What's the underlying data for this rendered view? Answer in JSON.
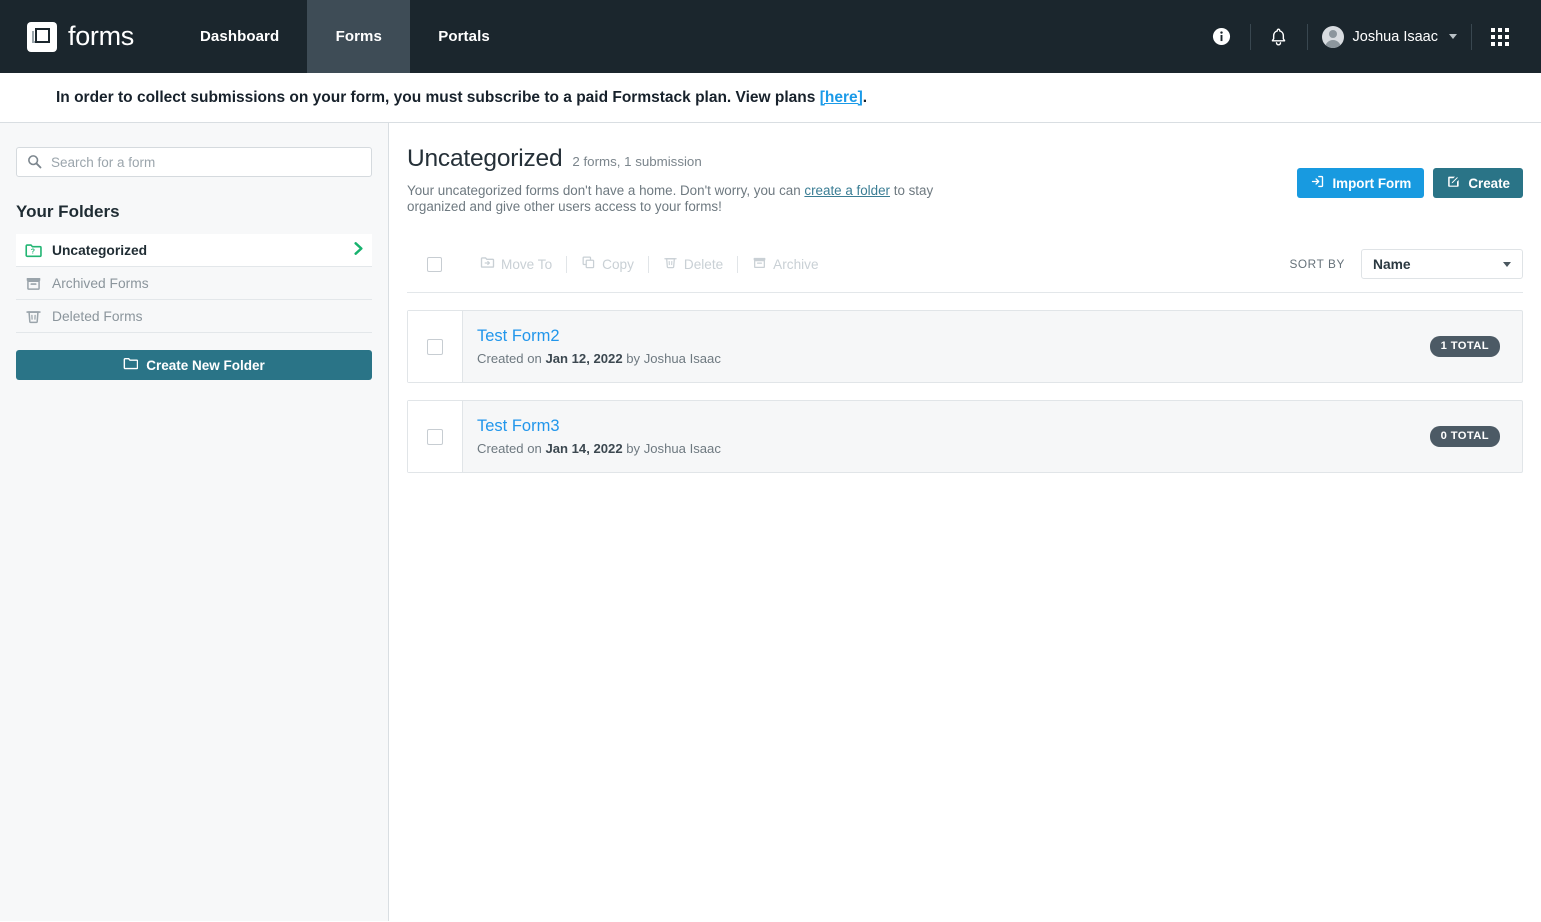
{
  "topnav": {
    "brand_label": "forms",
    "brand_logo_icon": "formstack-logo-icon",
    "tabs": [
      {
        "label": "Dashboard",
        "active": false
      },
      {
        "label": "Forms",
        "active": true
      },
      {
        "label": "Portals",
        "active": false
      }
    ],
    "info_icon": "info-circle-icon",
    "notifications_icon": "bell-icon",
    "avatar_icon": "user-avatar-icon",
    "user_name": "Joshua Isaac",
    "user_caret_icon": "chevron-down-icon",
    "apps_grid_icon": "apps-grid-icon"
  },
  "banner": {
    "text_before": "In order to collect submissions on your form, you must subscribe to a paid Formstack plan. View plans ",
    "link_text": "[here]",
    "text_after": "."
  },
  "sidebar": {
    "search": {
      "placeholder": "Search for a form",
      "value": "",
      "icon": "search-icon"
    },
    "folders_heading": "Your Folders",
    "items": [
      {
        "label": "Uncategorized",
        "icon": "folder-question-icon",
        "active": true,
        "chevron_icon": "chevron-right-icon"
      },
      {
        "label": "Archived Forms",
        "icon": "archive-box-icon",
        "active": false
      },
      {
        "label": "Deleted Forms",
        "icon": "trash-icon",
        "active": false
      }
    ],
    "create_folder": {
      "label": "Create New Folder",
      "icon": "folder-plus-icon"
    }
  },
  "main": {
    "title": "Uncategorized",
    "subcount": "2 forms, 1 submission",
    "description_before": "Your uncategorized forms don't have a home. Don't worry, you can ",
    "description_link": "create a folder",
    "description_after": " to stay organized and give other users access to your forms!",
    "import_button": {
      "label": "Import Form",
      "icon": "import-icon"
    },
    "create_button": {
      "label": "Create",
      "icon": "pencil-square-icon"
    },
    "toolbar": {
      "select_all_icon": "checkbox-unchecked-icon",
      "actions": [
        {
          "label": "Move To",
          "icon": "move-to-folder-icon",
          "disabled": true
        },
        {
          "label": "Copy",
          "icon": "copy-icon",
          "disabled": true
        },
        {
          "label": "Delete",
          "icon": "trash-icon",
          "disabled": true
        },
        {
          "label": "Archive",
          "icon": "archive-box-icon",
          "disabled": true
        }
      ]
    },
    "sort": {
      "label": "SORT BY",
      "value": "Name",
      "caret_icon": "caret-down-icon"
    },
    "forms": [
      {
        "name": "Test Form2",
        "created_prefix": "Created on ",
        "created_date": "Jan 12, 2022",
        "created_by": " by Joshua Isaac",
        "total_badge": "1 TOTAL",
        "checkbox_icon": "checkbox-unchecked-icon"
      },
      {
        "name": "Test Form3",
        "created_prefix": "Created on ",
        "created_date": "Jan 14, 2022",
        "created_by": " by Joshua Isaac",
        "total_badge": "0 TOTAL",
        "checkbox_icon": "checkbox-unchecked-icon"
      }
    ]
  },
  "colors": {
    "nav_bg": "#1b262d",
    "nav_active_tab": "#3e4c56",
    "accent_teal": "#2a7487",
    "accent_blue": "#189ae0",
    "link_blue": "#2196eb",
    "folder_green": "#22b573",
    "badge_slate": "#4c5a65",
    "panel_bg": "#f7f8f9"
  }
}
